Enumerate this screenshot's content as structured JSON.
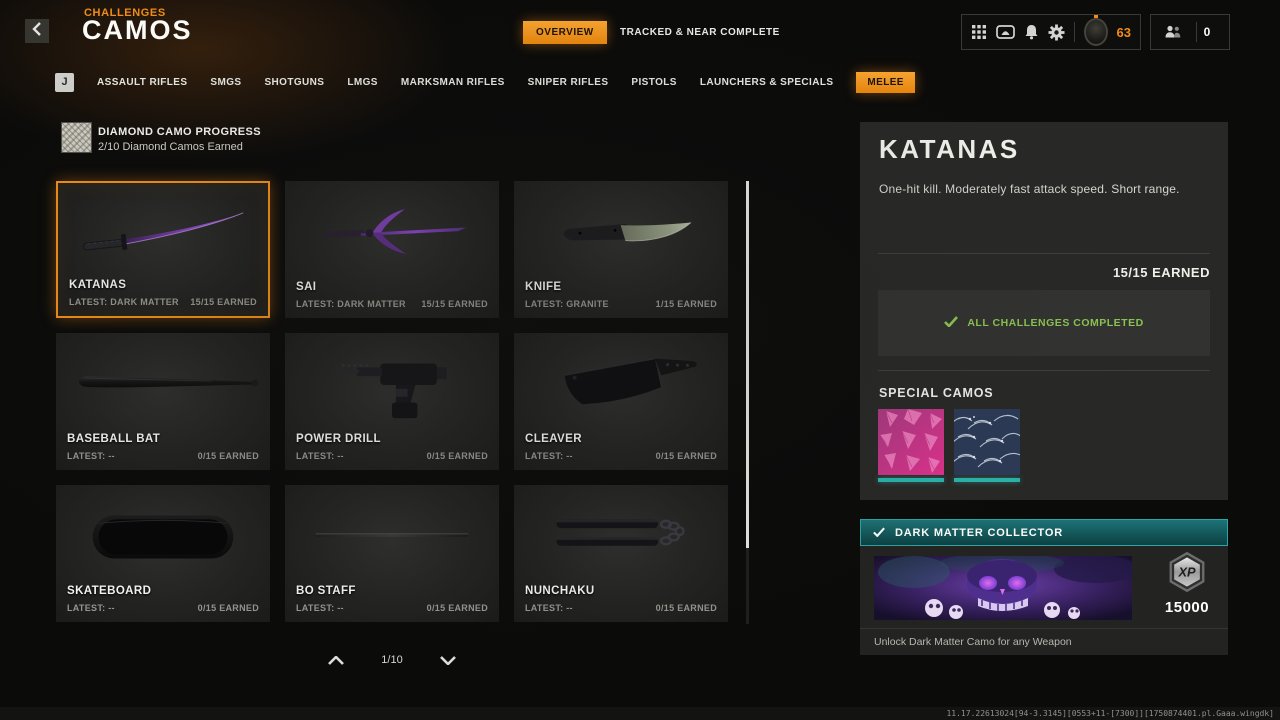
{
  "colors": {
    "accent_orange": "#f08c17",
    "teal": "#2bb3aa",
    "success_green": "#8cc452"
  },
  "header": {
    "eyebrow": "CHALLENGES",
    "title": "CAMOS",
    "nav_tabs": [
      {
        "label": "OVERVIEW",
        "active": true
      },
      {
        "label": "TRACKED & NEAR COMPLETE",
        "active": false
      }
    ],
    "hud": {
      "level": "63",
      "party_count": "0",
      "icons": [
        "grid-menu-icon",
        "gallery-icon",
        "notifications-bell-icon",
        "settings-gear-icon",
        "rank-emblem-icon",
        "social-party-icon"
      ]
    }
  },
  "category_tabs": {
    "key_hint": "J",
    "items": [
      {
        "label": "ASSAULT RIFLES"
      },
      {
        "label": "SMGS"
      },
      {
        "label": "SHOTGUNS"
      },
      {
        "label": "LMGS"
      },
      {
        "label": "MARKSMAN RIFLES"
      },
      {
        "label": "SNIPER RIFLES"
      },
      {
        "label": "PISTOLS"
      },
      {
        "label": "LAUNCHERS & SPECIALS"
      },
      {
        "label": "MELEE",
        "active": true
      }
    ]
  },
  "diamond_progress": {
    "title": "DIAMOND CAMO PROGRESS",
    "subtitle": "2/10 Diamond Camos Earned"
  },
  "weapons": [
    {
      "name": "KATANAS",
      "latest": "LATEST: DARK MATTER",
      "earned": "15/15 EARNED",
      "selected": true,
      "art": "katana"
    },
    {
      "name": "SAI",
      "latest": "LATEST: DARK MATTER",
      "earned": "15/15 EARNED",
      "art": "sai"
    },
    {
      "name": "KNIFE",
      "latest": "LATEST: GRANITE",
      "earned": "1/15 EARNED",
      "art": "knife"
    },
    {
      "name": "BASEBALL BAT",
      "latest": "LATEST: --",
      "earned": "0/15 EARNED",
      "art": "bat"
    },
    {
      "name": "POWER DRILL",
      "latest": "LATEST: --",
      "earned": "0/15 EARNED",
      "art": "drill"
    },
    {
      "name": "CLEAVER",
      "latest": "LATEST: --",
      "earned": "0/15 EARNED",
      "art": "cleaver"
    },
    {
      "name": "SKATEBOARD",
      "latest": "LATEST: --",
      "earned": "0/15 EARNED",
      "art": "skateboard"
    },
    {
      "name": "BO STAFF",
      "latest": "LATEST: --",
      "earned": "0/15 EARNED",
      "art": "bostaff"
    },
    {
      "name": "NUNCHAKU",
      "latest": "LATEST: --",
      "earned": "0/15 EARNED",
      "art": "nunchaku"
    }
  ],
  "pagination": {
    "page": "1/10"
  },
  "detail": {
    "title": "KATANAS",
    "description": "One-hit kill.  Moderately fast attack speed. Short range.",
    "earned": "15/15 EARNED",
    "completed": "ALL CHALLENGES COMPLETED",
    "special_camos_title": "SPECIAL CAMOS",
    "special_camos": [
      {
        "name": "pink-petal-camo",
        "art": "camo_pink"
      },
      {
        "name": "wave-camo",
        "art": "camo_wave"
      }
    ]
  },
  "collector": {
    "title": "DARK MATTER COLLECTOR",
    "xp_label": "XP",
    "xp_value": "15000",
    "caption": "Unlock Dark Matter Camo for any Weapon"
  },
  "footer": {
    "version": "11.17.22613024[94-3.3145][0553+11-[7300]][1750874401.pl.Gaaa.wingdk]"
  }
}
